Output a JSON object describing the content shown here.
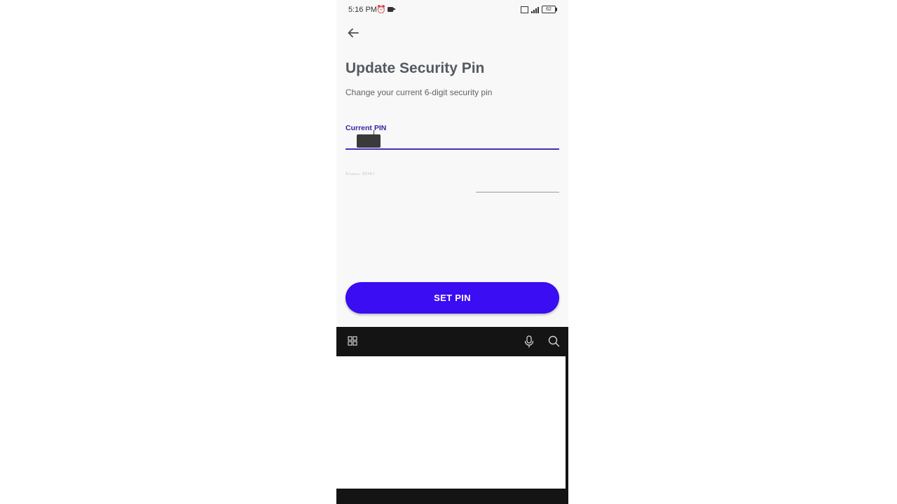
{
  "status_bar": {
    "time": "5:16 PM",
    "battery": "62"
  },
  "page": {
    "title": "Update Security Pin",
    "subtitle": "Change your current 6-digit security pin"
  },
  "current_pin": {
    "label": "Current PIN",
    "value": ""
  },
  "new_pin": {
    "label": "New PIN"
  },
  "set_pin_button": {
    "label": "SET PIN"
  },
  "colors": {
    "accent": "#3a0df2",
    "field_active": "#4a2bb8",
    "title": "#555a62"
  },
  "icons": {
    "back": "arrow-left-icon",
    "keyboard_menu": "grid-icon",
    "voice": "microphone-icon",
    "search": "search-icon"
  }
}
